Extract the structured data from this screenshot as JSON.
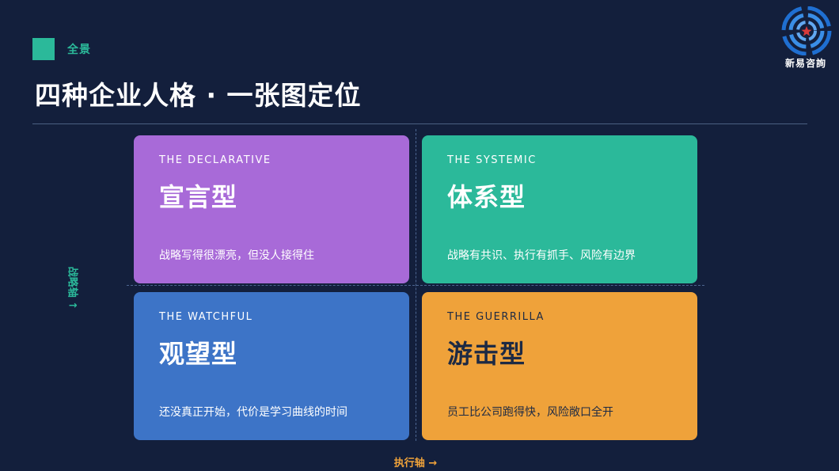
{
  "header": {
    "section_label": "全景",
    "title": "四种企业人格 · 一张图定位"
  },
  "logo": {
    "text": "新易咨詢"
  },
  "axes": {
    "y_label": "战略轴 ↑",
    "x_label": "执行轴 →"
  },
  "quadrants": [
    {
      "eyebrow": "THE DECLARATIVE",
      "title": "宣言型",
      "desc": "战略写得很漂亮，但没人接得住",
      "color": "#a86ad8"
    },
    {
      "eyebrow": "THE SYSTEMIC",
      "title": "体系型",
      "desc": "战略有共识、执行有抓手、风险有边界",
      "color": "#2bb99a"
    },
    {
      "eyebrow": "THE WATCHFUL",
      "title": "观望型",
      "desc": "还没真正开始，代价是学习曲线的时间",
      "color": "#3d74c7"
    },
    {
      "eyebrow": "THE GUERRILLA",
      "title": "游击型",
      "desc": "员工比公司跑得快，风险敞口全开",
      "color": "#efa23a"
    }
  ],
  "colors": {
    "background": "#131f3c",
    "accent_green": "#2bb99a",
    "accent_orange": "#efa23a"
  }
}
